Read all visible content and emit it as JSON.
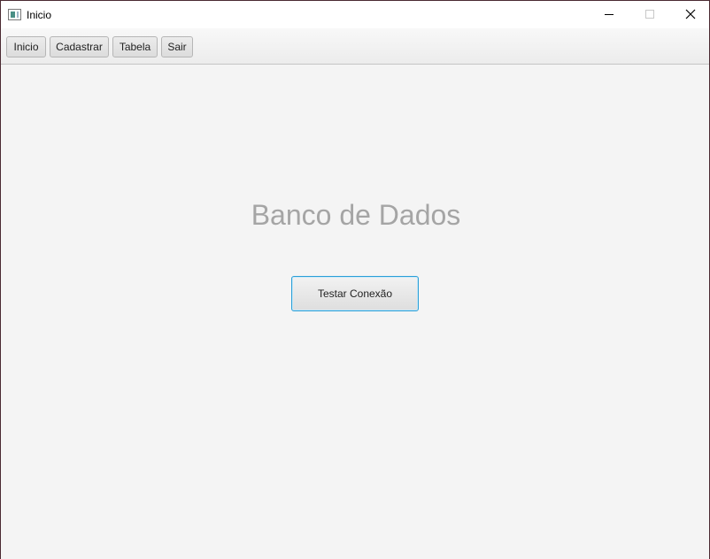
{
  "window": {
    "title": "Inicio",
    "controls": {
      "minimize": "minimize-icon",
      "maximize": "maximize-icon",
      "close": "close-icon"
    }
  },
  "toolbar": {
    "buttons": [
      "Inicio",
      "Cadastrar",
      "Tabela",
      "Sair"
    ]
  },
  "main": {
    "heading": "Banco de Dados",
    "test_button_label": "Testar Conexão"
  },
  "colors": {
    "background": "#f4f4f4",
    "heading": "#a5a5a5",
    "focus_border": "#2a9fd8"
  }
}
